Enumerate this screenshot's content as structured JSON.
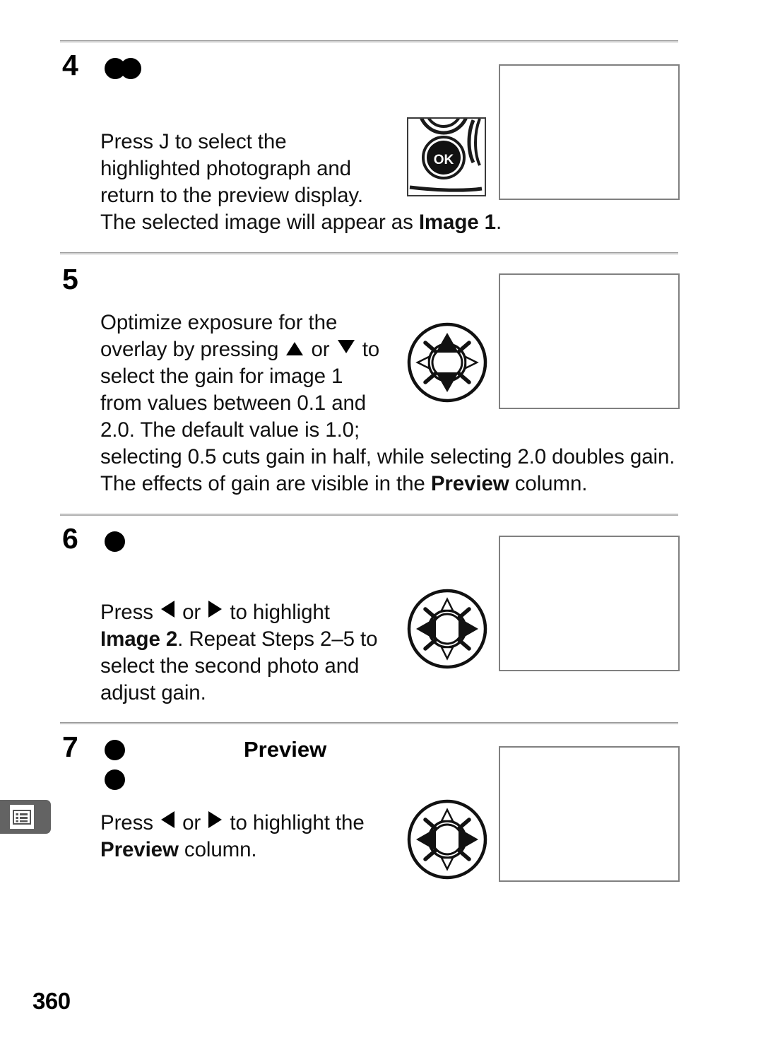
{
  "document": {
    "page_number": "360",
    "margin_tab_icon": "menu-list-icon"
  },
  "steps": [
    {
      "number": "4",
      "marker": "double-dot-icon",
      "title": "",
      "body_lines": [
        "Press J  to select the",
        "highlighted photograph and",
        "return to the preview display."
      ],
      "full_width_line_plain": "The selected image will appear as ",
      "full_width_line_bold": "Image 1",
      "full_width_line_tail": ".",
      "illustration": "ok-button-photo",
      "screen": "lcd-placeholder"
    },
    {
      "number": "5",
      "marker": "",
      "title": "",
      "body_lines": [
        "Optimize exposure for the",
        "overlay by pressing ▲ or ▼ to",
        "select the gain for image 1",
        "from values between 0.1 and",
        "2.0.  The default value is 1.0;"
      ],
      "wide_line_1": "selecting 0.5 cuts gain in half, while selecting 2.0 doubles gain.",
      "wide_line_2_plain_a": "The effects of gain are visible in the ",
      "wide_line_2_bold": "Preview",
      "wide_line_2_plain_b": " column.",
      "illustration": "multi-selector-up-down",
      "screen": "lcd-placeholder"
    },
    {
      "number": "6",
      "marker": "single-dot-icon",
      "title": "",
      "body_prefix": "Press ",
      "body_mid": " or ",
      "body_suffix": " to highlight",
      "body_bold": "Image 2",
      "body_rest": ".  Repeat Steps 2–5 to",
      "body_line3": "select the second photo and",
      "body_line4": "adjust gain.",
      "illustration": "multi-selector-left-right",
      "screen": "lcd-placeholder"
    },
    {
      "number": "7",
      "marker": "single-dot-icon",
      "marker2": "single-dot-icon",
      "title": "Preview",
      "body_prefix": "Press ",
      "body_mid": " or ",
      "body_suffix": " to highlight the",
      "body_bold": "Preview",
      "body_rest": " column.",
      "illustration": "multi-selector-left-right",
      "screen": "lcd-placeholder"
    }
  ],
  "colors": {
    "rule": "#9a9a9a",
    "box_border": "#808080",
    "tab_bg": "#636363",
    "text": "#000000"
  }
}
